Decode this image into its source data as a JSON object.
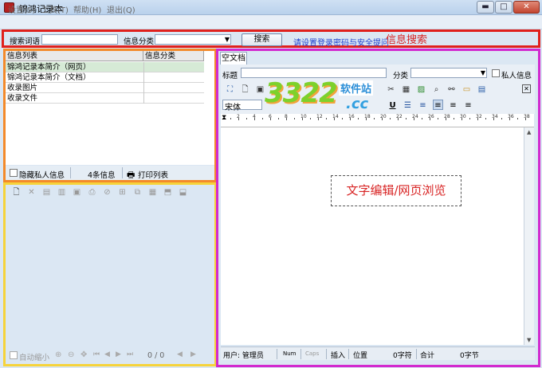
{
  "window": {
    "title": "锦鸿记录本",
    "minimize": "▬",
    "maximize": "□",
    "close": "✕"
  },
  "menu": [
    "设置(S)",
    "工具(T)",
    "帮助(H)",
    "退出(Q)"
  ],
  "search": {
    "keyword_label": "搜索词语",
    "keyword_value": "",
    "category_label": "信息分类",
    "category_value": "",
    "search_button": "搜索",
    "security_link": "请设置登录密码与安全提问",
    "annotation": "信息搜索"
  },
  "info_list": {
    "columns": [
      "信息列表",
      "信息分类"
    ],
    "rows": [
      {
        "name": "锦鸿记录本简介（网页）",
        "category": ""
      },
      {
        "name": "锦鸿记录本简介（文档）",
        "category": ""
      },
      {
        "name": "收录图片",
        "category": ""
      },
      {
        "name": "收录文件",
        "category": ""
      }
    ],
    "hide_private_label": "隐藏私人信息",
    "count_label": "4条信息",
    "print_label": "打印列表"
  },
  "lower_panel": {
    "auto_shrink_label": "自动缩小",
    "page_counter": "0 / 0"
  },
  "editor": {
    "tab_label": "空文档",
    "title_label": "标题",
    "title_value": "",
    "category_label": "分类",
    "category_value": "",
    "private_label": "私人信息",
    "font_value": "宋体",
    "annotation": "文字编辑/网页浏览",
    "ruler_numbers": [
      "2",
      "4",
      "6",
      "8",
      "10",
      "12",
      "14",
      "16",
      "18",
      "20",
      "22",
      "24",
      "26",
      "28",
      "30",
      "32",
      "34",
      "36",
      "38"
    ]
  },
  "statusbar": {
    "user": "用户: 管理员",
    "num": "Num",
    "caps": "Caps",
    "insert": "插入",
    "position_label": "位置",
    "position_value": "0字符",
    "total_label": "合计",
    "total_value": "0字节"
  },
  "watermark": {
    "number": "3322",
    "site": "软件站",
    "domain": ".cc"
  },
  "colors": {
    "search_box": "#e0201c",
    "list_box": "#f38a2b",
    "lower_box": "#f6d33a",
    "editor_box": "#d229cf",
    "annotation": "#d82424"
  }
}
